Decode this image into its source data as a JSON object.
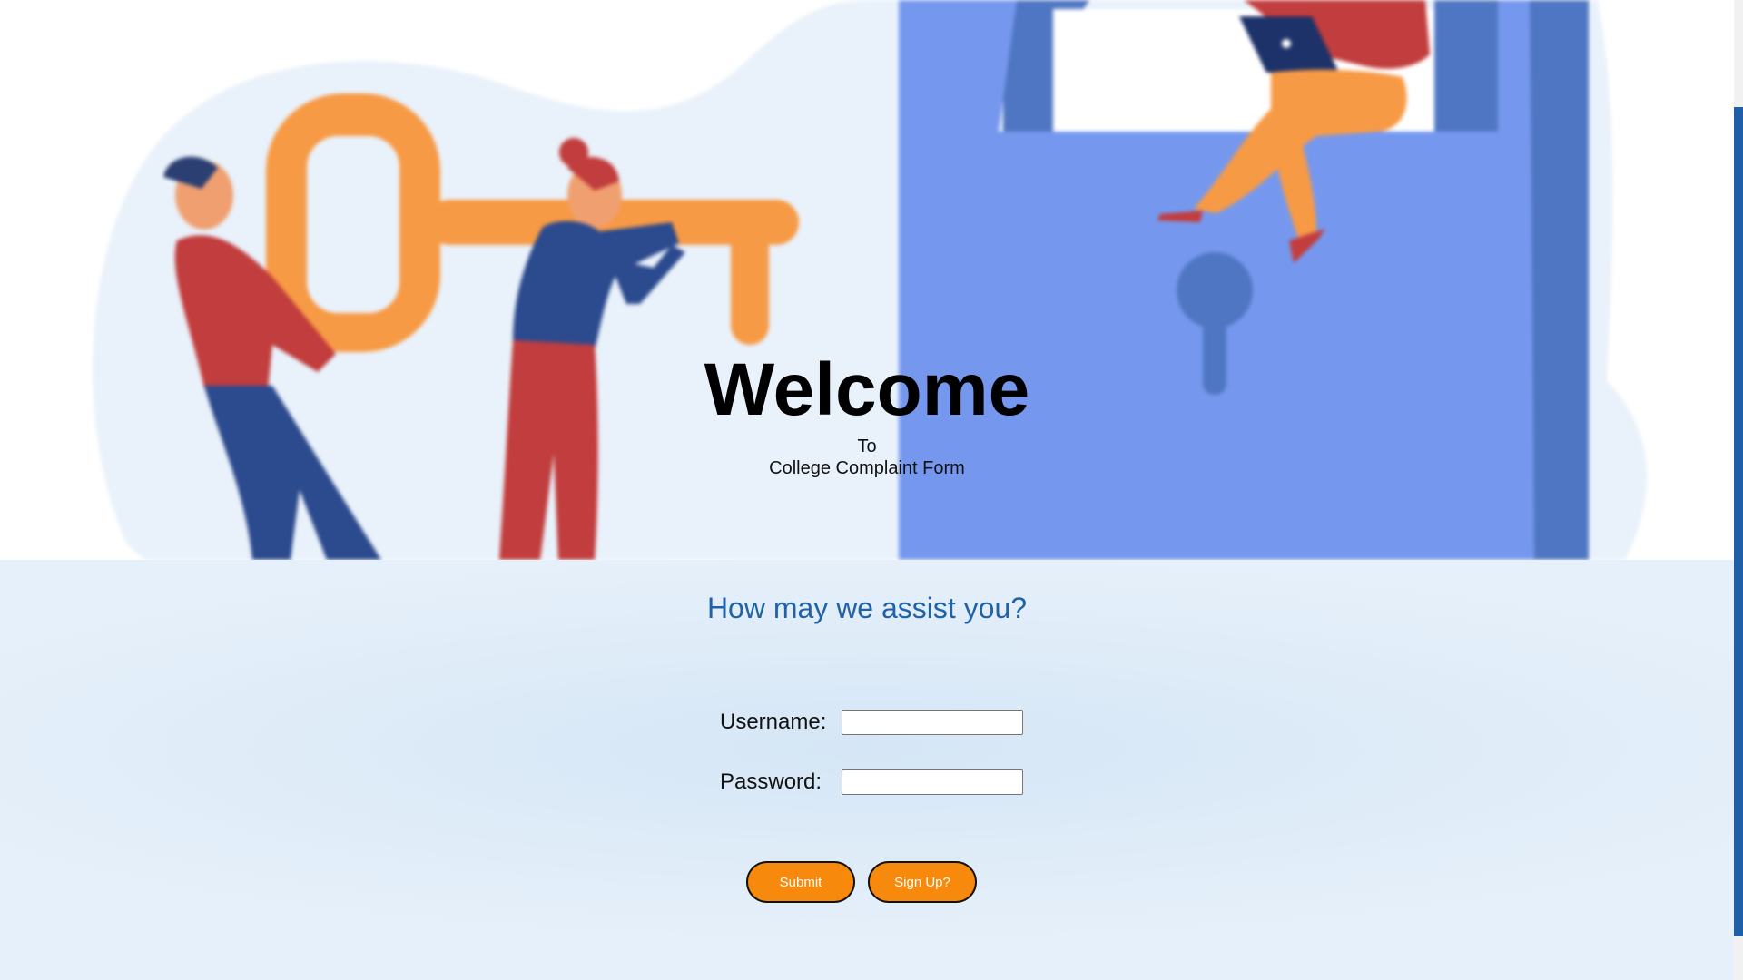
{
  "hero": {
    "title": "Welcome",
    "to": "To",
    "subtitle": "College Complaint Form"
  },
  "form": {
    "heading": "How may we assist you?",
    "username_label": "Username:",
    "username_value": "",
    "password_label": "Password:",
    "password_value": "",
    "submit_label": "Submit",
    "signup_label": "Sign Up?"
  },
  "colors": {
    "accent_orange": "#f7890c",
    "heading_blue": "#1f62a8",
    "lock_blue": "#7598ee",
    "scrollbar_thumb": "#1f5fa8"
  },
  "illustration": {
    "icons": [
      "key-icon",
      "padlock-icon",
      "person-icon",
      "laptop-icon"
    ]
  }
}
